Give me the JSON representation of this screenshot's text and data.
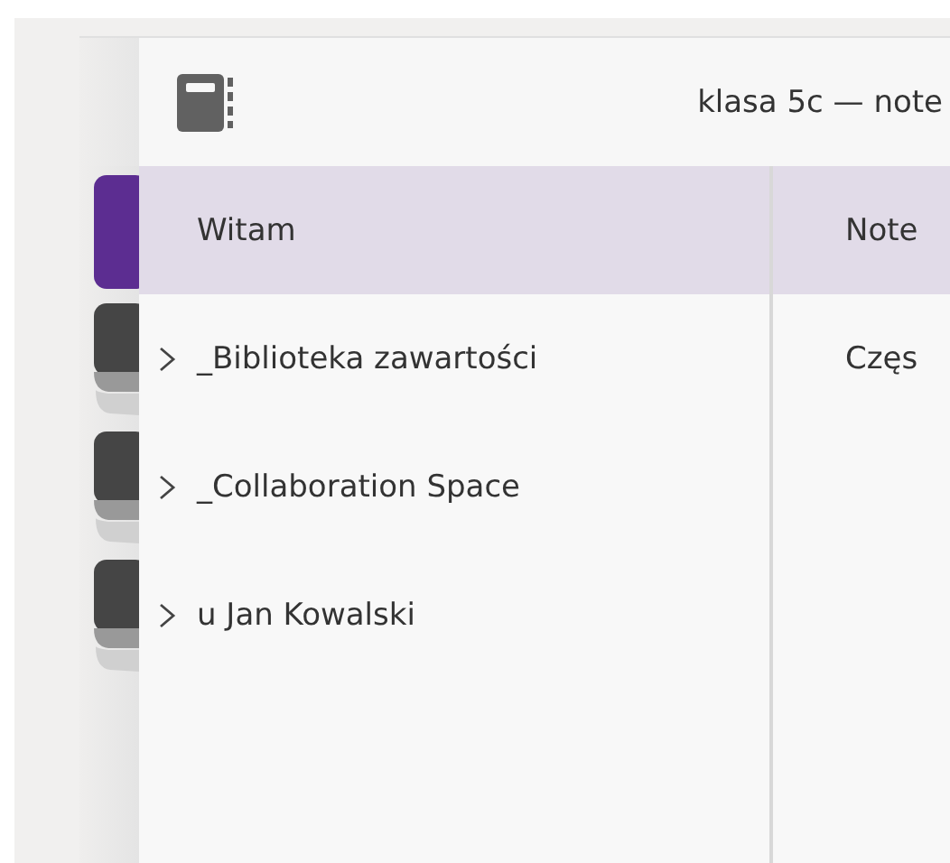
{
  "header": {
    "title": "klasa 5c — note"
  },
  "sections": [
    {
      "name": "Witam",
      "selected": true,
      "expandable": false,
      "color": "#5c2d91"
    },
    {
      "name": "_Biblioteka zawartości",
      "selected": false,
      "expandable": true,
      "color": "#454545"
    },
    {
      "name": "_Collaboration Space",
      "selected": false,
      "expandable": true,
      "color": "#454545"
    },
    {
      "name": "u Jan Kowalski",
      "selected": false,
      "expandable": true,
      "color": "#454545"
    }
  ],
  "pages": [
    {
      "title": "Note",
      "selected": true
    },
    {
      "title": "Częs",
      "selected": false
    }
  ]
}
